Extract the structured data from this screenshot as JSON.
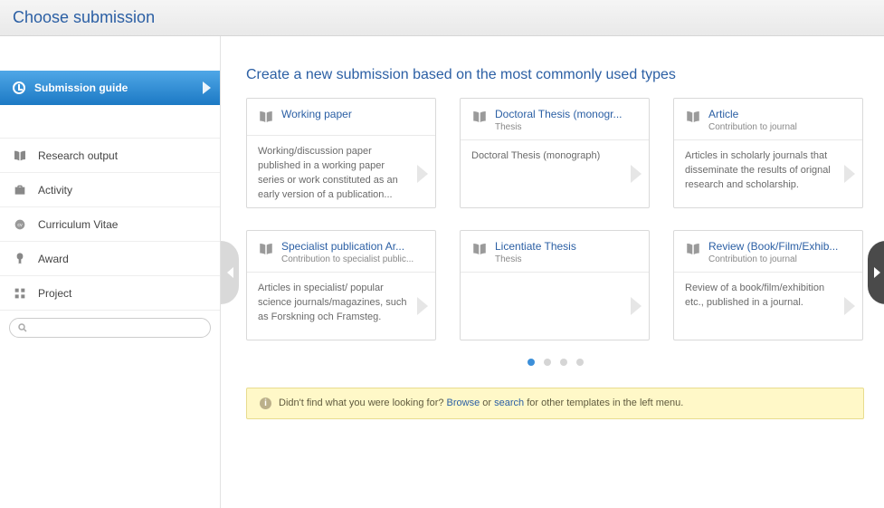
{
  "header": {
    "title": "Choose submission"
  },
  "sidebar": {
    "guide_label": "Submission guide",
    "items": [
      {
        "icon": "book-icon",
        "label": "Research output"
      },
      {
        "icon": "briefcase-icon",
        "label": "Activity"
      },
      {
        "icon": "cv-icon",
        "label": "Curriculum Vitae"
      },
      {
        "icon": "award-icon",
        "label": "Award"
      },
      {
        "icon": "project-icon",
        "label": "Project"
      }
    ],
    "search_placeholder": ""
  },
  "main": {
    "title": "Create a new submission based on the most commonly used types",
    "cards": [
      {
        "title": "Working paper",
        "subtitle": "",
        "desc": "Working/discussion paper published in a working paper series or work constituted as an early version of a publication..."
      },
      {
        "title": "Doctoral Thesis (monogr...",
        "subtitle": "Thesis",
        "desc": "Doctoral Thesis (monograph)"
      },
      {
        "title": "Article",
        "subtitle": "Contribution to journal",
        "desc": "Articles in scholarly journals that disseminate the results of orignal research and scholarship."
      },
      {
        "title": "Specialist publication Ar...",
        "subtitle": "Contribution to specialist public...",
        "desc": "Articles in specialist/ popular science journals/magazines, such as Forskning och Framsteg."
      },
      {
        "title": "Licentiate Thesis",
        "subtitle": "Thesis",
        "desc": ""
      },
      {
        "title": "Review (Book/Film/Exhib...",
        "subtitle": "Contribution to journal",
        "desc": "Review of a book/film/exhibition etc., published in a journal."
      }
    ],
    "pager": {
      "total": 4,
      "active": 0
    },
    "notice": {
      "prefix": "Didn't find what you were looking for? ",
      "browse": "Browse",
      "or": " or ",
      "search": "search",
      "suffix": " for other templates in the left menu."
    }
  }
}
